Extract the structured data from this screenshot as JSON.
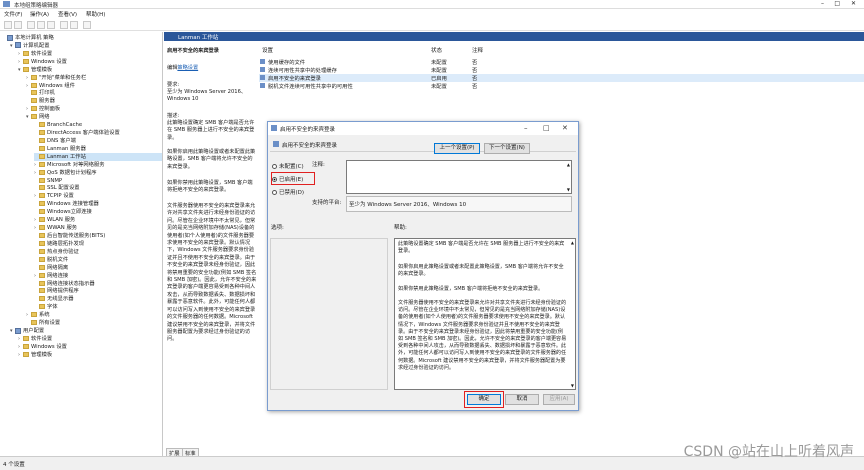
{
  "window": {
    "title": "本地组策略编辑器"
  },
  "menu": [
    "文件(F)",
    "操作(A)",
    "查看(V)",
    "帮助(H)"
  ],
  "tree": [
    {
      "label": "本地计算机 策略",
      "level": 0,
      "icon": "policy-icon",
      "arrow": ""
    },
    {
      "label": "计算机配置",
      "level": 1,
      "icon": "policy-icon",
      "arrow": "▾"
    },
    {
      "label": "软件设置",
      "level": 2,
      "icon": "folder-icon",
      "arrow": "›"
    },
    {
      "label": "Windows 设置",
      "level": 2,
      "icon": "folder-icon",
      "arrow": "›"
    },
    {
      "label": "管理模板",
      "level": 2,
      "icon": "folder-icon",
      "arrow": "▾"
    },
    {
      "label": "\"开始\"菜单和任务栏",
      "level": 3,
      "icon": "folder-icon",
      "arrow": "›"
    },
    {
      "label": "Windows 组件",
      "level": 3,
      "icon": "folder-icon",
      "arrow": "›"
    },
    {
      "label": "打印机",
      "level": 3,
      "icon": "folder-icon",
      "arrow": ""
    },
    {
      "label": "服务器",
      "level": 3,
      "icon": "folder-icon",
      "arrow": ""
    },
    {
      "label": "控制面板",
      "level": 3,
      "icon": "folder-icon",
      "arrow": "›"
    },
    {
      "label": "网络",
      "level": 3,
      "icon": "folder-icon",
      "arrow": "▾"
    },
    {
      "label": "BranchCache",
      "level": 4,
      "icon": "folder-icon",
      "arrow": ""
    },
    {
      "label": "DirectAccess 客户端体验设置",
      "level": 4,
      "icon": "folder-icon",
      "arrow": ""
    },
    {
      "label": "DNS 客户端",
      "level": 4,
      "icon": "folder-icon",
      "arrow": ""
    },
    {
      "label": "Lanman 服务器",
      "level": 4,
      "icon": "folder-icon",
      "arrow": ""
    },
    {
      "label": "Lanman 工作站",
      "level": 4,
      "icon": "folder-icon",
      "arrow": "",
      "selected": true
    },
    {
      "label": "Microsoft 对等网络服务",
      "level": 4,
      "icon": "folder-icon",
      "arrow": "›"
    },
    {
      "label": "QoS 数据包计划程序",
      "level": 4,
      "icon": "folder-icon",
      "arrow": "›"
    },
    {
      "label": "SNMP",
      "level": 4,
      "icon": "folder-icon",
      "arrow": ""
    },
    {
      "label": "SSL 配置设置",
      "level": 4,
      "icon": "folder-icon",
      "arrow": ""
    },
    {
      "label": "TCPIP 设置",
      "level": 4,
      "icon": "folder-icon",
      "arrow": "›"
    },
    {
      "label": "Windows 连接管理器",
      "level": 4,
      "icon": "folder-icon",
      "arrow": ""
    },
    {
      "label": "Windows立即连接",
      "level": 4,
      "icon": "folder-icon",
      "arrow": ""
    },
    {
      "label": "WLAN 服务",
      "level": 4,
      "icon": "folder-icon",
      "arrow": "›"
    },
    {
      "label": "WWAN 服务",
      "level": 4,
      "icon": "folder-icon",
      "arrow": "›"
    },
    {
      "label": "后台智能传送服务(BITS)",
      "level": 4,
      "icon": "folder-icon",
      "arrow": ""
    },
    {
      "label": "链路层拓扑发现",
      "level": 4,
      "icon": "folder-icon",
      "arrow": ""
    },
    {
      "label": "热点身份验证",
      "level": 4,
      "icon": "folder-icon",
      "arrow": ""
    },
    {
      "label": "脱机文件",
      "level": 4,
      "icon": "folder-icon",
      "arrow": ""
    },
    {
      "label": "网络隔离",
      "level": 4,
      "icon": "folder-icon",
      "arrow": ""
    },
    {
      "label": "网络连接",
      "level": 4,
      "icon": "folder-icon",
      "arrow": "›"
    },
    {
      "label": "网络连接状态指示器",
      "level": 4,
      "icon": "folder-icon",
      "arrow": ""
    },
    {
      "label": "网络提供程序",
      "level": 4,
      "icon": "folder-icon",
      "arrow": ""
    },
    {
      "label": "无线显示器",
      "level": 4,
      "icon": "folder-icon",
      "arrow": ""
    },
    {
      "label": "字体",
      "level": 4,
      "icon": "folder-icon",
      "arrow": ""
    },
    {
      "label": "系统",
      "level": 3,
      "icon": "folder-icon",
      "arrow": "›"
    },
    {
      "label": "所有设置",
      "level": 3,
      "icon": "folder-icon",
      "arrow": ""
    },
    {
      "label": "用户配置",
      "level": 1,
      "icon": "policy-icon",
      "arrow": "▾"
    },
    {
      "label": "软件设置",
      "level": 2,
      "icon": "folder-icon",
      "arrow": "›"
    },
    {
      "label": "Windows 设置",
      "level": 2,
      "icon": "folder-icon",
      "arrow": "›"
    },
    {
      "label": "管理模板",
      "level": 2,
      "icon": "folder-icon",
      "arrow": "›"
    }
  ],
  "header": {
    "title": "Lanman 工作站"
  },
  "desc": {
    "policy_name": "启用不安全的来宾登录",
    "edit_link_prefix": "编辑",
    "edit_link": "策略设置",
    "req_label": "要求:",
    "req_text": "至少为 Windows Server 2016、Windows 10",
    "desc_label": "描述:",
    "p1": "此策略设置确定 SMB 客户端是否允许在 SMB 服务器上进行不安全的来宾登录。",
    "p2": "如果你启用此策略设置或者未配置此策略设置，SMB 客户端将允许不安全的来宾登录。",
    "p3": "如果你禁用此策略设置，SMB 客户端将拒绝不安全的来宾登录。",
    "p4": "文件服务器使用不安全的来宾登录来允许对共享文件夹进行未经身份验证的访问。尽管在企业环境中不太常见，但常见的是充当网络附加存储(NAS)设备的使用者(如个人使用者)的文件服务器要求使用不安全的来宾登录。默认情况下，Windows 文件服务器要求身份验证并且不使用不安全的来宾登录。由于不安全的来宾登录未经身份验证，因此将禁用重要的安全功能(例如 SMB 签名和 SMB 加密)。因此，允许不安全的来宾登录的客户端更容易受到各种中间人攻击，从而导致数据丢失、数据损坏和暴露于恶意软件。此外，可能任何人都可以访问写入到使用不安全的来宾登录的文件服务器的任何数据。Microsoft 建议禁用不安全的来宾登录，并将文件服务器配置为要求经过身份验证的访问。"
  },
  "list": {
    "headers": [
      "设置",
      "状态",
      "注释"
    ],
    "rows": [
      {
        "name": "使用缓存的文件",
        "status": "未配置",
        "note": "否"
      },
      {
        "name": "连续可用性共享中的处理缓存",
        "status": "未配置",
        "note": "否"
      },
      {
        "name": "启用不安全的来宾登录",
        "status": "已启用",
        "note": "否",
        "highlight": true
      },
      {
        "name": "脱机文件连续可用性共享中的可用性",
        "status": "未配置",
        "note": "否"
      }
    ]
  },
  "tabs": [
    "扩展",
    "标准"
  ],
  "status": {
    "text": "4 个设置"
  },
  "watermark": "CSDN @站在山上听着风声",
  "dialog": {
    "title": "启用不安全的来宾登录",
    "setting_name": "启用不安全的来宾登录",
    "prev_button": "上一个设置(P)",
    "next_button": "下一个设置(N)",
    "radio_not_configured": "未配置(C)",
    "radio_enabled": "已启用(E)",
    "radio_disabled": "已禁用(D)",
    "note_label": "注释:",
    "platform_label": "支持的平台:",
    "platform_text": "至少为 Windows Server 2016、Windows 10",
    "options_label": "选项:",
    "help_label": "帮助:",
    "help_p1": "此策略设置确定 SMB 客户端是否允许在 SMB 服务器上进行不安全的来宾登录。",
    "help_p2": "如果你启用此策略设置或者未配置此策略设置，SMB 客户端将允许不安全的来宾登录。",
    "help_p3": "如果你禁用此策略设置，SMB 客户端将拒绝不安全的来宾登录。",
    "help_p4": "文件服务器使用不安全的来宾登录来允许对共享文件夹进行未经身份验证的访问。尽管在企业环境中不太常见，但常见的是充当网络附加存储(NAS)设备的使用者(如个人使用者)的文件服务器要求使用不安全的来宾登录。默认情况下，Windows 文件服务器要求身份验证并且不使用不安全的来宾登录。由于不安全的来宾登录未经身份验证，因此将禁用重要的安全功能(例如 SMB 签名和 SMB 加密)。因此，允许不安全的来宾登录的客户端更容易受到各种中间人攻击，从而导致数据丢失、数据损坏和暴露于恶意软件。此外，可能任何人都可以访问写入到使用不安全的来宾登录的文件服务器的任何数据。Microsoft 建议禁用不安全的来宾登录，并将文件服务器配置为要求经过身份验证的访问。",
    "ok_button": "确定",
    "cancel_button": "取消",
    "apply_button": "应用(A)",
    "selected_option": "enabled"
  }
}
